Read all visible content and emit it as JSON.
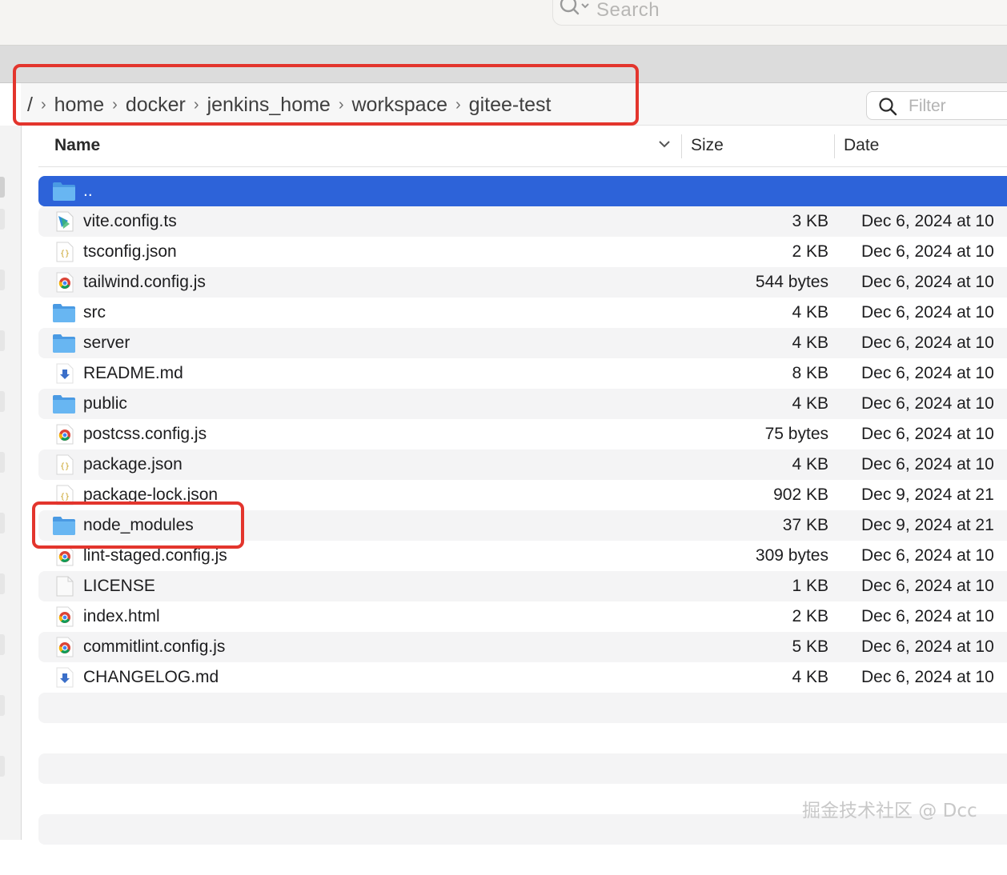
{
  "toolbar": {
    "search_placeholder": "Search"
  },
  "path": {
    "root": "/",
    "segments": [
      "home",
      "docker",
      "jenkins_home",
      "workspace",
      "gitee-test"
    ],
    "filter_placeholder": "Filter"
  },
  "columns": {
    "name": "Name",
    "size": "Size",
    "date": "Date"
  },
  "files": [
    {
      "name": "..",
      "size": "",
      "date": "",
      "icon": "folder-icon",
      "selected": true
    },
    {
      "name": "vite.config.ts",
      "size": "3 KB",
      "date": "Dec 6, 2024 at 10",
      "icon": "typescript-file-icon"
    },
    {
      "name": "tsconfig.json",
      "size": "2 KB",
      "date": "Dec 6, 2024 at 10",
      "icon": "json-file-icon"
    },
    {
      "name": "tailwind.config.js",
      "size": "544 bytes",
      "date": "Dec 6, 2024 at 10",
      "icon": "chrome-js-file-icon"
    },
    {
      "name": "src",
      "size": "4 KB",
      "date": "Dec 6, 2024 at 10",
      "icon": "folder-icon"
    },
    {
      "name": "server",
      "size": "4 KB",
      "date": "Dec 6, 2024 at 10",
      "icon": "folder-icon"
    },
    {
      "name": "README.md",
      "size": "8 KB",
      "date": "Dec 6, 2024 at 10",
      "icon": "markdown-file-icon"
    },
    {
      "name": "public",
      "size": "4 KB",
      "date": "Dec 6, 2024 at 10",
      "icon": "folder-icon"
    },
    {
      "name": "postcss.config.js",
      "size": "75 bytes",
      "date": "Dec 6, 2024 at 10",
      "icon": "chrome-js-file-icon"
    },
    {
      "name": "package.json",
      "size": "4 KB",
      "date": "Dec 6, 2024 at 10",
      "icon": "json-file-icon"
    },
    {
      "name": "package-lock.json",
      "size": "902 KB",
      "date": "Dec 9, 2024 at 21",
      "icon": "json-file-icon"
    },
    {
      "name": "node_modules",
      "size": "37 KB",
      "date": "Dec 9, 2024 at 21",
      "icon": "folder-icon"
    },
    {
      "name": "lint-staged.config.js",
      "size": "309 bytes",
      "date": "Dec 6, 2024 at 10",
      "icon": "chrome-js-file-icon"
    },
    {
      "name": "LICENSE",
      "size": "1 KB",
      "date": "Dec 6, 2024 at 10",
      "icon": "blank-file-icon"
    },
    {
      "name": "index.html",
      "size": "2 KB",
      "date": "Dec 6, 2024 at 10",
      "icon": "chrome-js-file-icon"
    },
    {
      "name": "commitlint.config.js",
      "size": "5 KB",
      "date": "Dec 6, 2024 at 10",
      "icon": "chrome-js-file-icon"
    },
    {
      "name": "CHANGELOG.md",
      "size": "4 KB",
      "date": "Dec 6, 2024 at 10",
      "icon": "markdown-file-icon"
    }
  ],
  "watermark": "掘金技术社区 @ Dcc",
  "colors": {
    "selection": "#2d63d9",
    "annotation": "#e3352d",
    "folder": "#5aa9ea"
  }
}
